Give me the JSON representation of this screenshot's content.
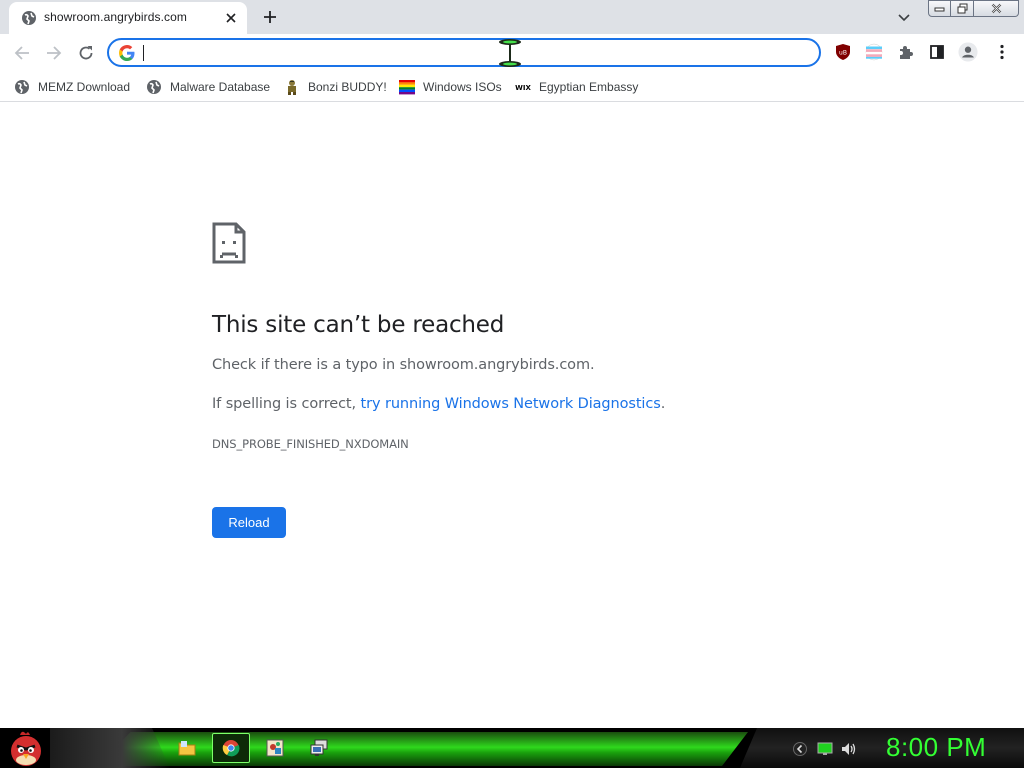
{
  "tab": {
    "title": "showroom.angrybirds.com",
    "favicon": "globe-icon"
  },
  "omnibox": {
    "value": "",
    "search_engine_icon": "google-g-icon"
  },
  "bookmarks": [
    {
      "label": "MEMZ Download",
      "icon": "globe-icon"
    },
    {
      "label": "Malware Database",
      "icon": "globe-icon"
    },
    {
      "label": "Bonzi BUDDY!",
      "icon": "bonzi-icon"
    },
    {
      "label": "Windows ISOs",
      "icon": "rainbow-flag-icon"
    },
    {
      "label": "Egyptian Embassy",
      "icon": "wix-icon"
    }
  ],
  "error": {
    "title": "This site can’t be reached",
    "typo_line": "Check if there is a typo in showroom.angrybirds.com.",
    "spelling_prefix": "If spelling is correct, ",
    "diagnostics_link": "try running Windows Network Diagnostics",
    "spelling_suffix": ".",
    "code": "DNS_PROBE_FINISHED_NXDOMAIN",
    "reload_label": "Reload"
  },
  "taskbar": {
    "clock": "8:00 PM",
    "apps": [
      "file-explorer-icon",
      "chrome-icon",
      "paint-icon",
      "remote-desktop-icon"
    ]
  },
  "colors": {
    "accent": "#1a73e8",
    "clock": "#33ff33",
    "taskbar_glow": "#2fd81d"
  }
}
